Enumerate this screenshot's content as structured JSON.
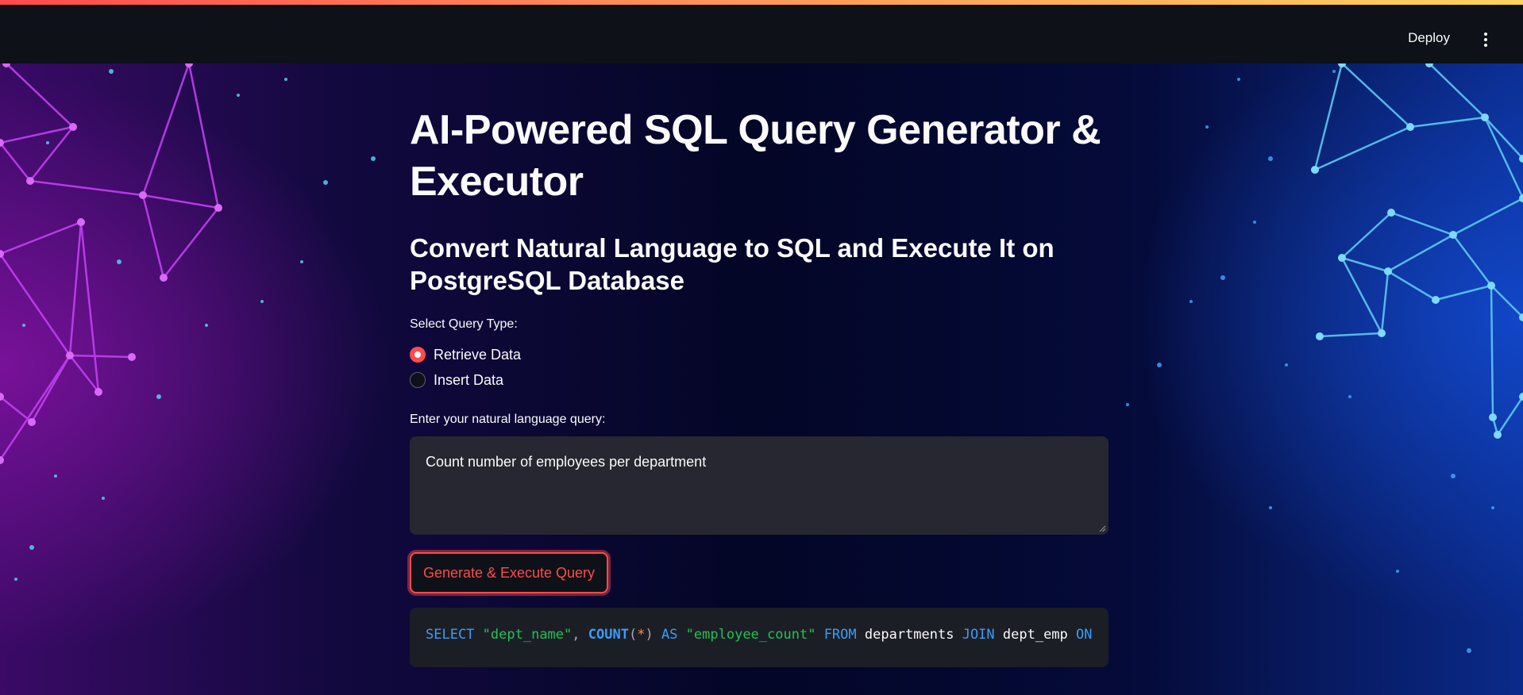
{
  "topbar": {
    "deploy_label": "Deploy",
    "menu_icon": "kebab-menu-icon",
    "accent_gradient": [
      "#ff4b4b",
      "#fdd35c"
    ]
  },
  "main": {
    "title": "AI-Powered SQL Query Generator & Executor",
    "subtitle": "Convert Natural Language to SQL and Execute It on PostgreSQL Database",
    "query_type": {
      "label": "Select Query Type:",
      "options": [
        {
          "label": "Retrieve Data",
          "selected": true
        },
        {
          "label": "Insert Data",
          "selected": false
        }
      ]
    },
    "nl_query": {
      "label": "Enter your natural language query:",
      "value": "Count number of employees per department"
    },
    "generate_button": "Generate & Execute Query",
    "generated_sql": [
      {
        "t": "SELECT",
        "c": "kw"
      },
      {
        "t": " ",
        "c": ""
      },
      {
        "t": "\"dept_name\"",
        "c": "str"
      },
      {
        "t": ", ",
        "c": "pn"
      },
      {
        "t": "COUNT",
        "c": "kwb"
      },
      {
        "t": "(",
        "c": "pn"
      },
      {
        "t": "*",
        "c": "op"
      },
      {
        "t": ")",
        "c": "pn"
      },
      {
        "t": " ",
        "c": ""
      },
      {
        "t": "AS",
        "c": "kw"
      },
      {
        "t": " ",
        "c": ""
      },
      {
        "t": "\"employee_count\"",
        "c": "str"
      },
      {
        "t": " ",
        "c": ""
      },
      {
        "t": "FROM",
        "c": "kw"
      },
      {
        "t": " departments ",
        "c": ""
      },
      {
        "t": "JOIN",
        "c": "kw"
      },
      {
        "t": " dept_emp ",
        "c": ""
      },
      {
        "t": "ON",
        "c": "kw"
      }
    ]
  },
  "colors": {
    "primary": "#ff4b4b",
    "background": "#0e1117",
    "input_bg": "#262730",
    "code_bg": "#1c1e26"
  }
}
